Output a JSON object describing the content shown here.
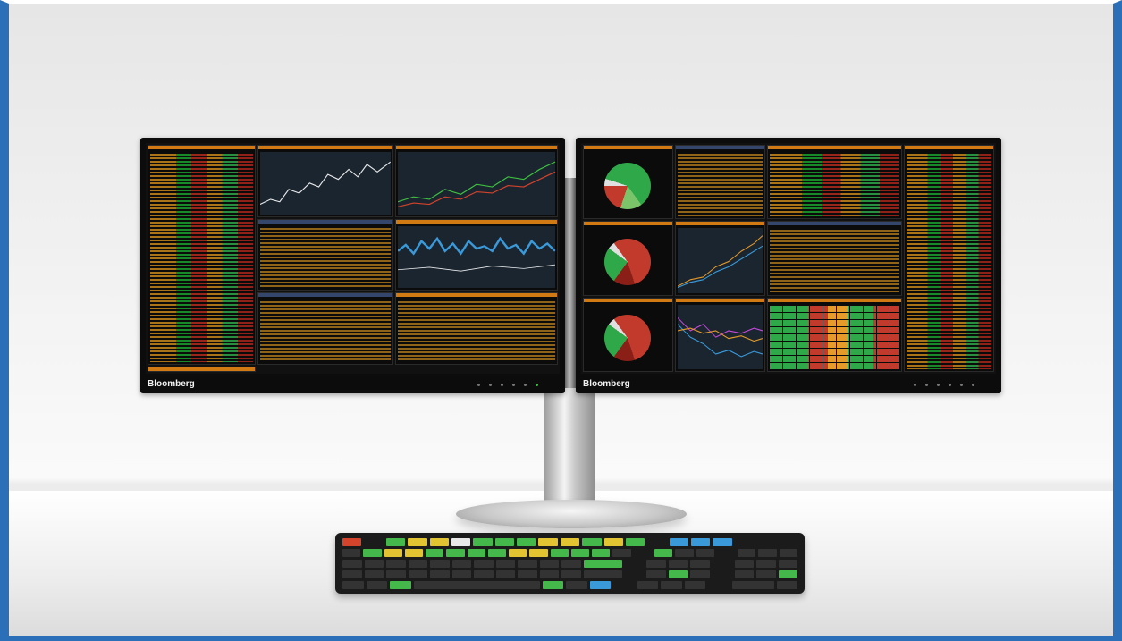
{
  "scene": {
    "left_monitor": {
      "brand": "Bloomberg"
    },
    "right_monitor": {
      "brand": "Bloomberg"
    }
  },
  "colors": {
    "frame_border": "#2a6fb8",
    "terminal_amber": "#d17a14",
    "terminal_green": "#2fa84a",
    "terminal_red": "#c23a2c"
  },
  "icons": [
    "bloomberg-terminal-monitor",
    "bloomberg-keyboard",
    "monitor-stand"
  ]
}
